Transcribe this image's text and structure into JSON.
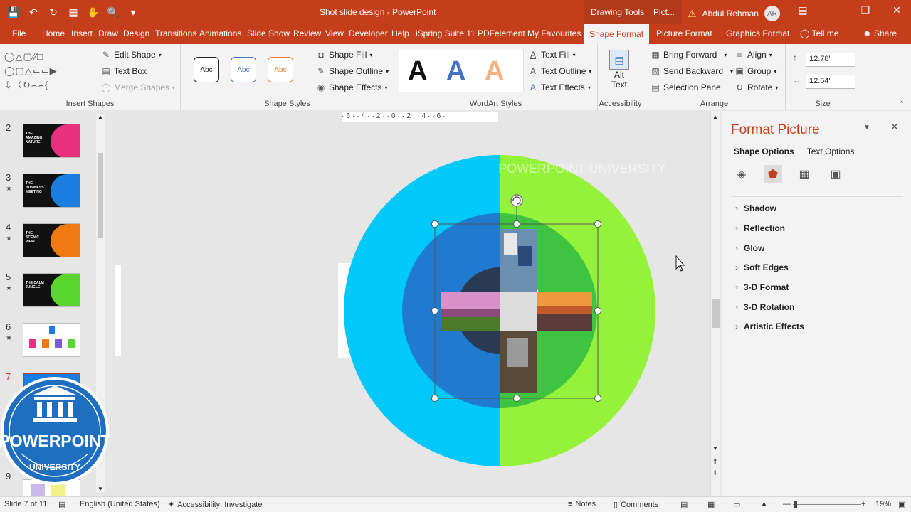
{
  "title_bar": {
    "document_title": "Shot slide design - PowerPoint",
    "context_tabs": [
      "Drawing Tools",
      "Pict..."
    ],
    "warning_icon": "warning-triangle-icon",
    "user_name": "Abdul Rehman",
    "user_initials": "AR"
  },
  "tabs": [
    "File",
    "Home",
    "Insert",
    "Draw",
    "Design",
    "Transitions",
    "Animations",
    "Slide Show",
    "Review",
    "View",
    "Developer",
    "Help",
    "iSpring Suite 11",
    "PDFelement",
    "My Favourites",
    "Shape Format",
    "Picture Format",
    "Graphics Format"
  ],
  "active_tab": "Shape Format",
  "tell_me": "Tell me",
  "share": "Share",
  "ribbon": {
    "insert_shapes": {
      "label": "Insert Shapes",
      "edit_shape": "Edit Shape",
      "text_box": "Text Box",
      "merge_shapes": "Merge Shapes"
    },
    "shape_styles": {
      "label": "Shape Styles",
      "style_sample": "Abc",
      "shape_fill": "Shape Fill",
      "shape_outline": "Shape Outline",
      "shape_effects": "Shape Effects"
    },
    "wordart_styles": {
      "label": "WordArt Styles",
      "sample_letter": "A",
      "text_fill": "Text Fill",
      "text_outline": "Text Outline",
      "text_effects": "Text Effects"
    },
    "accessibility": {
      "label": "Accessibility",
      "alt_text_line1": "Alt",
      "alt_text_line2": "Text"
    },
    "arrange": {
      "label": "Arrange",
      "bring_forward": "Bring Forward",
      "send_backward": "Send Backward",
      "selection_pane": "Selection Pane",
      "align": "Align",
      "group": "Group",
      "rotate": "Rotate"
    },
    "size": {
      "label": "Size",
      "height": "12.78\"",
      "width": "12.64\""
    }
  },
  "thumbnails": [
    {
      "num": "2",
      "text": "THE AMAZING NATURE",
      "color": "#e8317a",
      "star": false
    },
    {
      "num": "3",
      "text": "THE BUSINESS MEETING",
      "color": "#1a7ee0",
      "star": true
    },
    {
      "num": "4",
      "text": "THE SCENIC VIEW",
      "color": "#f07a12",
      "star": true
    },
    {
      "num": "5",
      "text": "THE CALM JUNGLE",
      "color": "#5ad62e",
      "star": true
    },
    {
      "num": "6",
      "text": "",
      "color": "#ffffff",
      "star": true
    },
    {
      "num": "7",
      "text": "",
      "color": "#1a7ee0",
      "star": false
    },
    {
      "num": "9",
      "text": "",
      "color": "#ffffff",
      "star": false
    }
  ],
  "slide": {
    "watermark": "POWERPOINT UNIVERSITY",
    "left_color": "#00c8f8",
    "right_color": "#95f23a",
    "mid_left_color": "#1f7ad0",
    "mid_right_color": "#3ec440",
    "inner_color": "#2a3a52"
  },
  "badge": {
    "line1": "POWERPOINT",
    "line2": "UNIVERSITY"
  },
  "format_pane": {
    "title": "Format Picture",
    "shape_options": "Shape Options",
    "text_options": "Text Options",
    "icons": [
      "fill-line-icon",
      "effects-pentagon-icon",
      "size-properties-icon",
      "picture-icon"
    ],
    "sections": [
      "Shadow",
      "Reflection",
      "Glow",
      "Soft Edges",
      "3-D Format",
      "3-D Rotation",
      "Artistic Effects"
    ]
  },
  "status": {
    "slide_info": "Slide 7 of 11",
    "language": "English (United States)",
    "accessibility": "Accessibility: Investigate",
    "notes": "Notes",
    "comments": "Comments",
    "zoom": "19%"
  }
}
